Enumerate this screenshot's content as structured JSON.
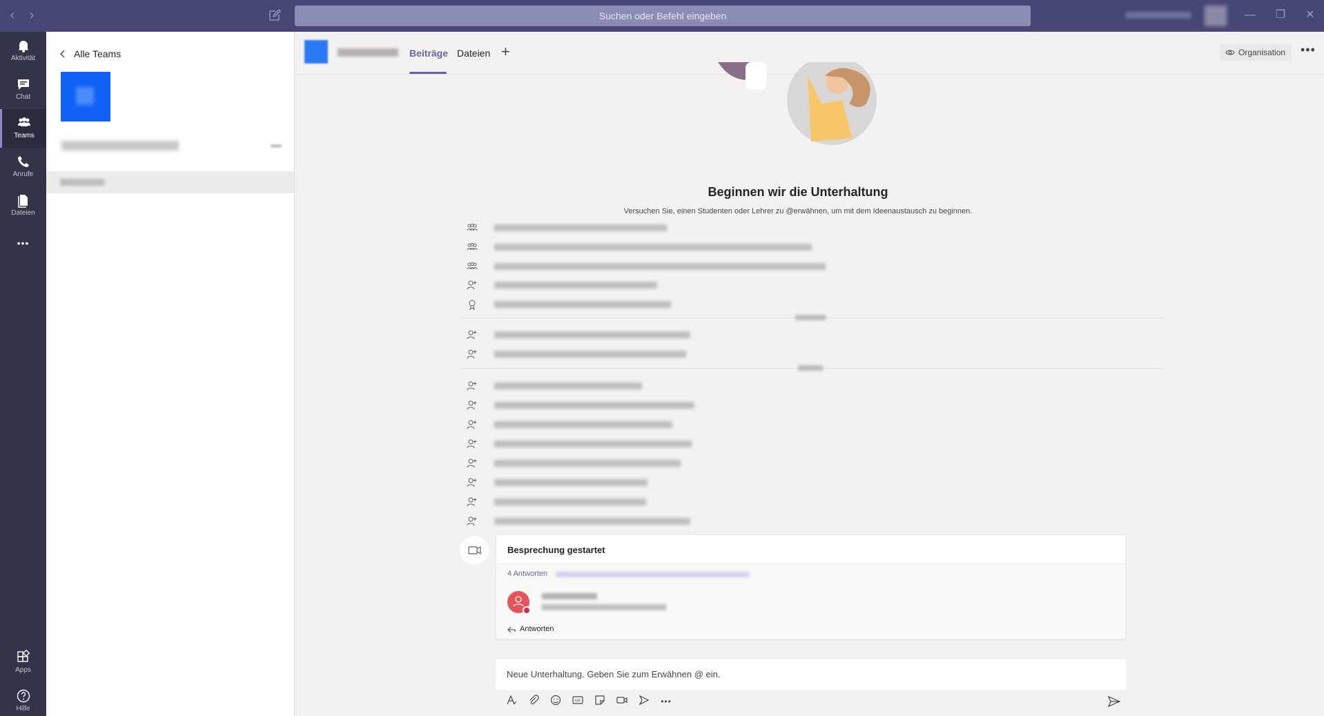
{
  "titlebar": {
    "search_placeholder": "Suchen oder Befehl eingeben",
    "back_glyph": "‹",
    "forward_glyph": "›",
    "minimize_glyph": "—",
    "restore_glyph": "❐",
    "close_glyph": "✕"
  },
  "rail": {
    "items": [
      {
        "label": "Aktivität",
        "icon": "bell-icon"
      },
      {
        "label": "Chat",
        "icon": "chat-icon"
      },
      {
        "label": "Teams",
        "icon": "teams-icon"
      },
      {
        "label": "Anrufe",
        "icon": "phone-icon"
      },
      {
        "label": "Dateien",
        "icon": "file-icon"
      },
      {
        "label": "",
        "icon": "more-icon"
      },
      {
        "label": "Apps",
        "icon": "apps-icon"
      },
      {
        "label": "Hilfe",
        "icon": "help-icon"
      }
    ],
    "more_glyph": "•••"
  },
  "leftpane": {
    "back_label": "Alle Teams"
  },
  "channel": {
    "tabs": [
      {
        "label": "Beiträge",
        "active": true
      },
      {
        "label": "Dateien",
        "active": false
      }
    ],
    "add_tab_glyph": "+",
    "org_label": "Organisation",
    "more_glyph": "•••"
  },
  "welcome": {
    "title": "Beginnen wir die Unterhaltung",
    "subtitle": "Versuchen Sie, einen Studenten oder Lehrer zu @erwähnen, um mit dem Ideenaustausch zu beginnen."
  },
  "meeting": {
    "title": "Besprechung gestartet",
    "replies": "4 Antworten",
    "reply_action": "Antworten"
  },
  "compose": {
    "placeholder": "Neue Unterhaltung. Geben Sie zum Erwähnen @ ein.",
    "tools": [
      "format-icon",
      "attach-icon",
      "emoji-icon",
      "gif-icon",
      "sticker-icon",
      "meet-icon",
      "stream-icon",
      "more-icon"
    ],
    "more_glyph": "•••"
  },
  "colors": {
    "accent": "#6264a7",
    "titlebar": "#464775",
    "rail": "#33344a",
    "team_blue": "#0f62f5"
  }
}
